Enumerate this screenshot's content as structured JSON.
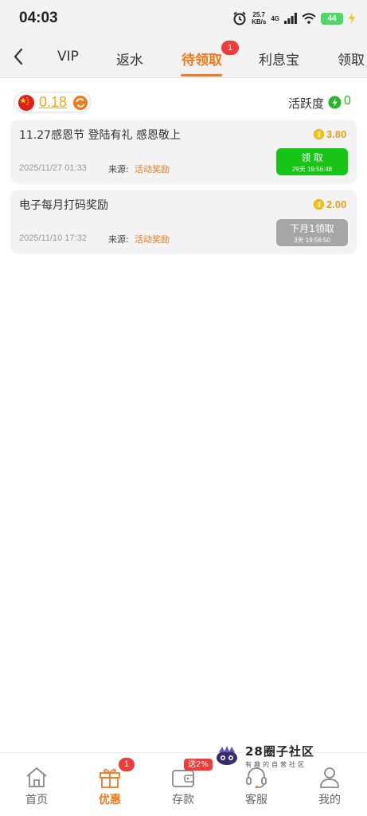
{
  "status_bar": {
    "time": "04:03",
    "speed_value": "25.7",
    "speed_unit": "KB/s",
    "network": "4G",
    "battery": "44"
  },
  "tabs": [
    {
      "label": "VIP"
    },
    {
      "label": "返水"
    },
    {
      "label": "待领取",
      "badge": "1",
      "active": true
    },
    {
      "label": "利息宝"
    },
    {
      "label": "领取"
    }
  ],
  "summary": {
    "balance": "0.18",
    "activity_label": "活跃度",
    "activity_value": "0"
  },
  "rewards": [
    {
      "title": "11.27感恩节 登陆有礼 感恩敬上",
      "amount": "3.80",
      "date": "2025/11/27 01:33",
      "source_label": "来源:",
      "source": "活动奖励",
      "button_label": "领 取",
      "button_sub": "29天 19:56:48",
      "button_state": "available"
    },
    {
      "title": "电子每月打码奖励",
      "amount": "2.00",
      "date": "2025/11/10 17:32",
      "source_label": "来源:",
      "source": "活动奖励",
      "button_label": "下月1领取",
      "button_sub": "3天 19:56:50",
      "button_state": "pending"
    }
  ],
  "bottom_nav": {
    "home": "首页",
    "promo": "优惠",
    "promo_badge": "1",
    "deposit": "存款",
    "deposit_tag": "送2%",
    "service": "客服",
    "mine": "我的"
  },
  "watermark": {
    "title": "28圈子社区",
    "subtitle": "有趣的自营社区"
  },
  "colors": {
    "accent": "#f07a1c",
    "claim_green": "#16c516",
    "pending_gray": "#a6a6a6",
    "badge_red": "#ee3b3b",
    "coin_gold": "#f5c518"
  }
}
